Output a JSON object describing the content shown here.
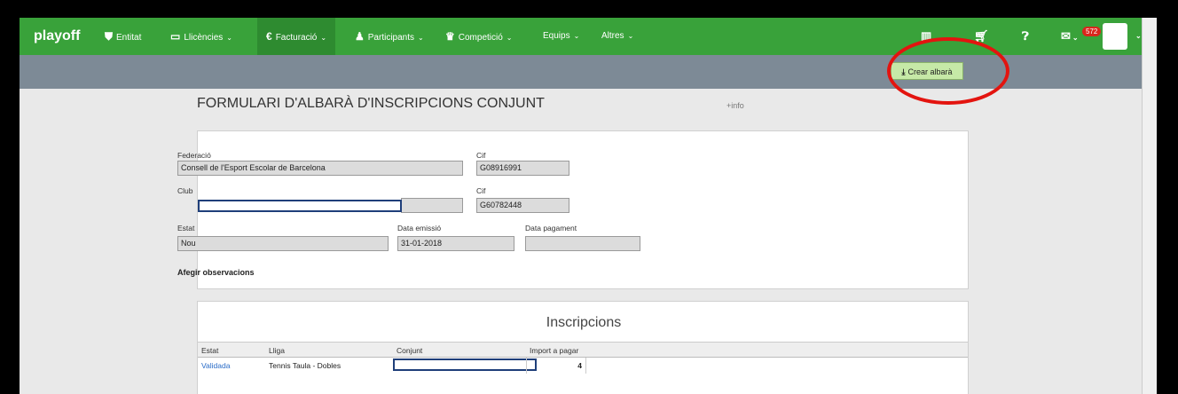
{
  "nav": {
    "brand": "playoff",
    "items": [
      {
        "label": "Entitat",
        "icon": "shield-icon",
        "glyph": "⛊",
        "chevron": false
      },
      {
        "label": "Llicències",
        "icon": "id-card-icon",
        "glyph": "▭",
        "chevron": true
      },
      {
        "label": "Facturació",
        "icon": "euro-icon",
        "glyph": "€",
        "chevron": true
      },
      {
        "label": "Participants",
        "icon": "user-icon",
        "glyph": "♟",
        "chevron": true
      },
      {
        "label": "Competició",
        "icon": "trophy-icon",
        "glyph": "♛",
        "chevron": true
      },
      {
        "label": "Equips",
        "icon": "",
        "glyph": "",
        "chevron": true
      },
      {
        "label": "Altres",
        "icon": "",
        "glyph": "",
        "chevron": true
      }
    ],
    "notifications": "572"
  },
  "toolbar": {
    "create_label": "Crear albarà"
  },
  "page": {
    "title": "FORMULARI D'ALBARÀ D'INSCRIPCIONS CONJUNT",
    "info": "+info"
  },
  "form": {
    "federacio_label": "Federació",
    "federacio_value": "Consell de l'Esport Escolar de Barcelona",
    "cif1_label": "Cif",
    "cif1_value": "G08916991",
    "club_label": "Club",
    "club_value": "",
    "cif2_label": "Cif",
    "cif2_value": "G60782448",
    "estat_label": "Estat",
    "estat_value": "Nou",
    "data_emissio_label": "Data emissió",
    "data_emissio_value": "31-01-2018",
    "data_pagament_label": "Data pagament",
    "data_pagament_value": "",
    "add_obs": "Afegir observacions"
  },
  "inscripcions": {
    "title": "Inscripcions",
    "columns": [
      "Estat",
      "Lliga",
      "Conjunt",
      "Import a pagar"
    ],
    "rows": [
      {
        "estat": "Validada",
        "lliga": "Tennis Taula - Dobles",
        "conjunt": "",
        "import": "4"
      }
    ]
  }
}
